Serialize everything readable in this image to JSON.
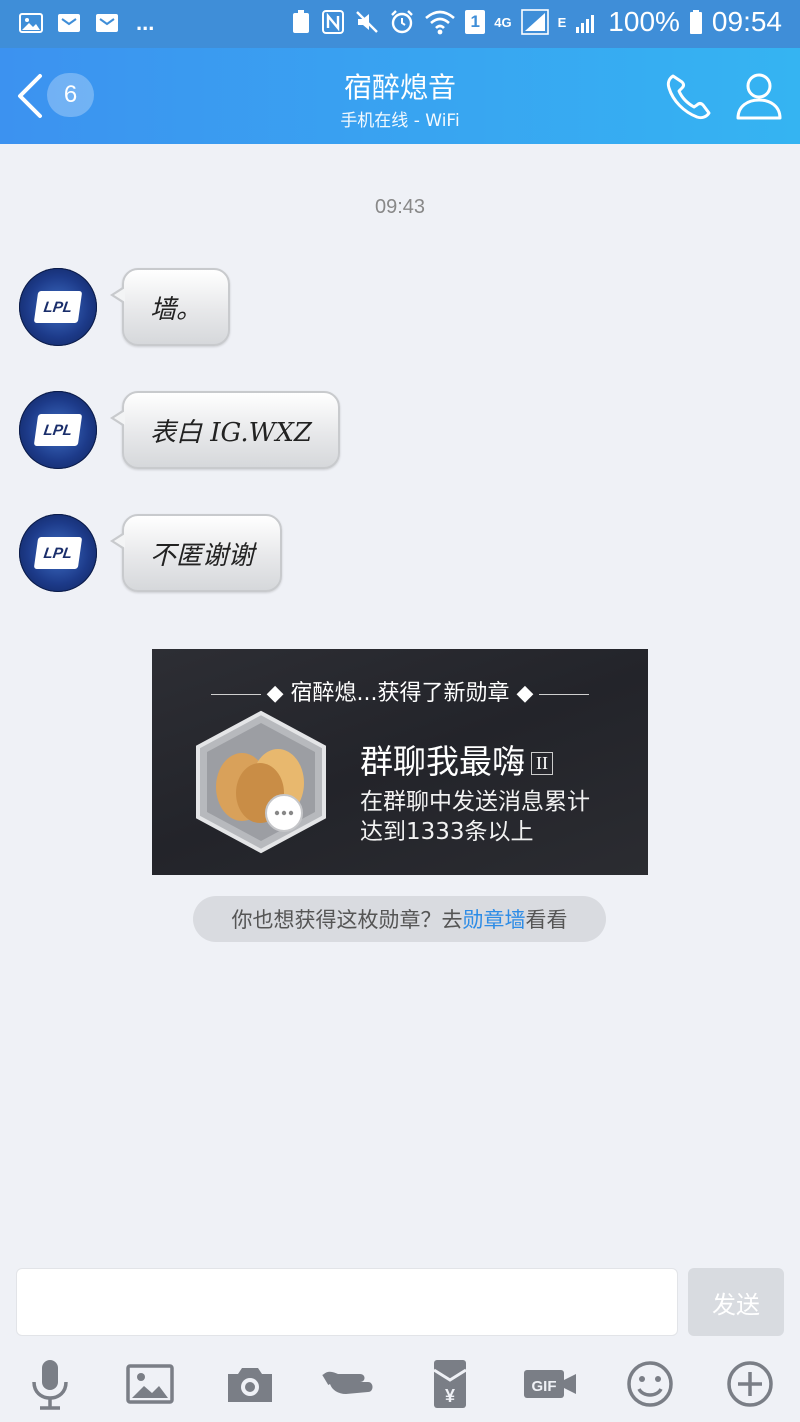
{
  "statusbar": {
    "dots": "...",
    "network_4g": "4G",
    "network_e": "E",
    "sim_badge": "1",
    "battery": "100%",
    "time": "09:54"
  },
  "header": {
    "unread_count": "6",
    "title": "宿醉熄音",
    "subtitle": "手机在线 - WiFi"
  },
  "chat": {
    "timestamp": "09:43",
    "messages": [
      {
        "avatar_text": "LPL",
        "text": "墙。"
      },
      {
        "avatar_text": "LPL",
        "text": "表白 IG.WXZ"
      },
      {
        "avatar_text": "LPL",
        "text": "不匿谢谢"
      }
    ]
  },
  "medal_card": {
    "headline": "宿醉熄...获得了新勋章",
    "name": "群聊我最嗨",
    "level": "II",
    "desc_line1": "在群聊中发送消息累计",
    "desc_line2": "达到1333条以上"
  },
  "tip": {
    "prefix": "你也想获得这枚勋章？去",
    "link": "勋章墙",
    "suffix": "看看"
  },
  "composer": {
    "send_label": "发送",
    "gif_label": "GIF"
  },
  "colors": {
    "header_start": "#3c92f0",
    "header_end": "#35b4f2",
    "link": "#2d8ce6",
    "background": "#eff1f6"
  }
}
